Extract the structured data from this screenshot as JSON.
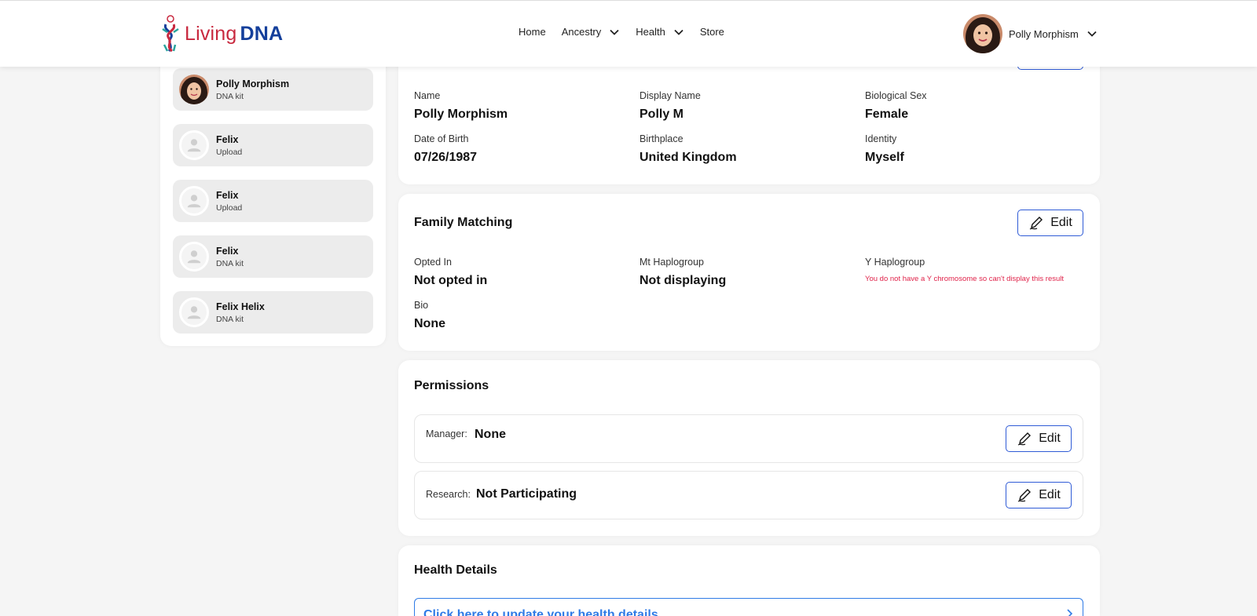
{
  "brand": {
    "living": "Living",
    "dna": "DNA"
  },
  "nav": {
    "home": "Home",
    "ancestry": "Ancestry",
    "health": "Health",
    "store": "Store"
  },
  "user": {
    "name": "Polly Morphism"
  },
  "sidebar": {
    "kits": [
      {
        "name": "Polly Morphism",
        "type": "DNA kit"
      },
      {
        "name": "Felix",
        "type": "Upload"
      },
      {
        "name": "Felix",
        "type": "Upload"
      },
      {
        "name": "Felix",
        "type": "DNA kit"
      },
      {
        "name": "Felix Helix",
        "type": "DNA kit"
      }
    ]
  },
  "profile": {
    "name_label": "Name",
    "name_value": "Polly Morphism",
    "display_label": "Display Name",
    "display_value": "Polly M",
    "sex_label": "Biological Sex",
    "sex_value": "Female",
    "dob_label": "Date of Birth",
    "dob_value": "07/26/1987",
    "birthplace_label": "Birthplace",
    "birthplace_value": "United Kingdom",
    "identity_label": "Identity",
    "identity_value": "Myself"
  },
  "family": {
    "title": "Family Matching",
    "edit_label": "Edit",
    "opted_label": "Opted In",
    "opted_value": "Not opted in",
    "mt_label": "Mt Haplogroup",
    "mt_value": "Not displaying",
    "y_label": "Y Haplogroup",
    "y_warning": "You do not have a Y chromosome so can't display this result",
    "bio_label": "Bio",
    "bio_value": "None"
  },
  "permissions": {
    "title": "Permissions",
    "manager_label": "Manager:",
    "manager_value": "None",
    "research_label": "Research:",
    "research_value": "Not Participating",
    "edit_label": "Edit"
  },
  "health": {
    "title": "Health Details",
    "link_text": "Click here to update your health details"
  },
  "colors": {
    "brand_red": "#c8283e",
    "brand_blue": "#143f9b",
    "accent": "#2f5bd6",
    "link": "#2f7be6",
    "warning": "#e0234a"
  }
}
